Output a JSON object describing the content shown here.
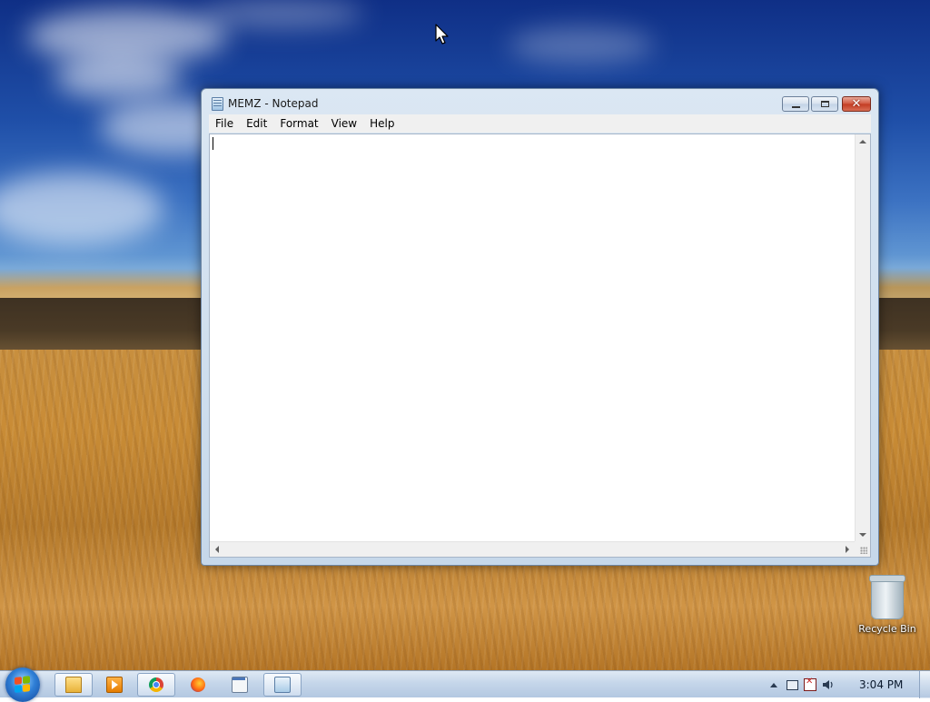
{
  "window": {
    "title": "MEMZ - Notepad",
    "menu": [
      "File",
      "Edit",
      "Format",
      "View",
      "Help"
    ],
    "content": ""
  },
  "desktop": {
    "icons": [
      {
        "label": "Recycle Bin",
        "icon": "recycle-bin-icon"
      }
    ]
  },
  "taskbar": {
    "pinned": [
      {
        "icon": "folder-icon"
      },
      {
        "icon": "media-player-icon"
      },
      {
        "icon": "chrome-icon"
      },
      {
        "icon": "firefox-icon"
      },
      {
        "icon": "window-icon"
      },
      {
        "icon": "notepad-icon",
        "active": true
      }
    ],
    "clock": "3:04 PM"
  },
  "colors": {
    "close_button": "#c33b22",
    "titlebar": "#c6d8ea",
    "taskbar": "#c5d6ea"
  }
}
